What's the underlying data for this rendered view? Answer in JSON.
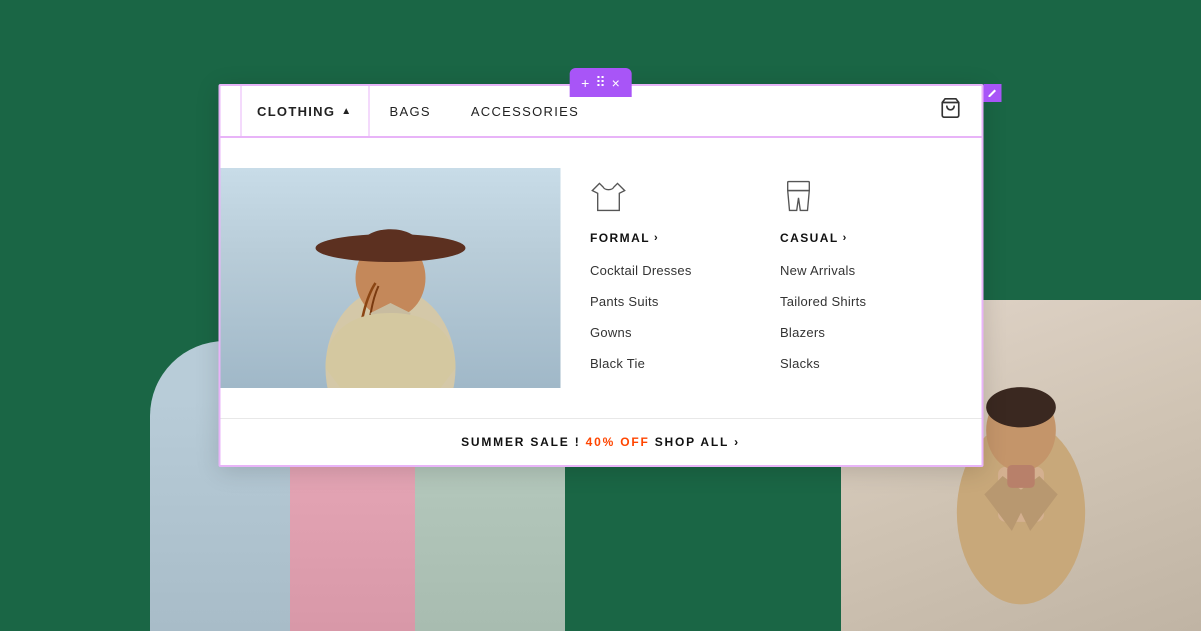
{
  "background": {
    "color": "#1a6645"
  },
  "toolbar": {
    "icons": [
      "+",
      "⠿",
      "×"
    ]
  },
  "nav": {
    "items": [
      {
        "label": "CLOTHING",
        "active": true,
        "chevron": "▲"
      },
      {
        "label": "BAGS",
        "active": false
      },
      {
        "label": "ACCESSORIES",
        "active": false
      }
    ],
    "cart_icon": "🛒"
  },
  "dropdown": {
    "formal": {
      "title": "FORMAL",
      "arrow": "›",
      "icon": "shirt",
      "links": [
        "Cocktail Dresses",
        "Pants Suits",
        "Gowns",
        "Black Tie"
      ]
    },
    "casual": {
      "title": "CASUAL",
      "arrow": "›",
      "icon": "pants",
      "links": [
        "New Arrivals",
        "Tailored Shirts",
        "Blazers",
        "Slacks"
      ]
    }
  },
  "sale_banner": {
    "prefix": "SUMMER SALE !",
    "highlight": "40% OFF",
    "suffix": "SHOP ALL",
    "arrow": "›"
  },
  "edit_icon": "✎"
}
